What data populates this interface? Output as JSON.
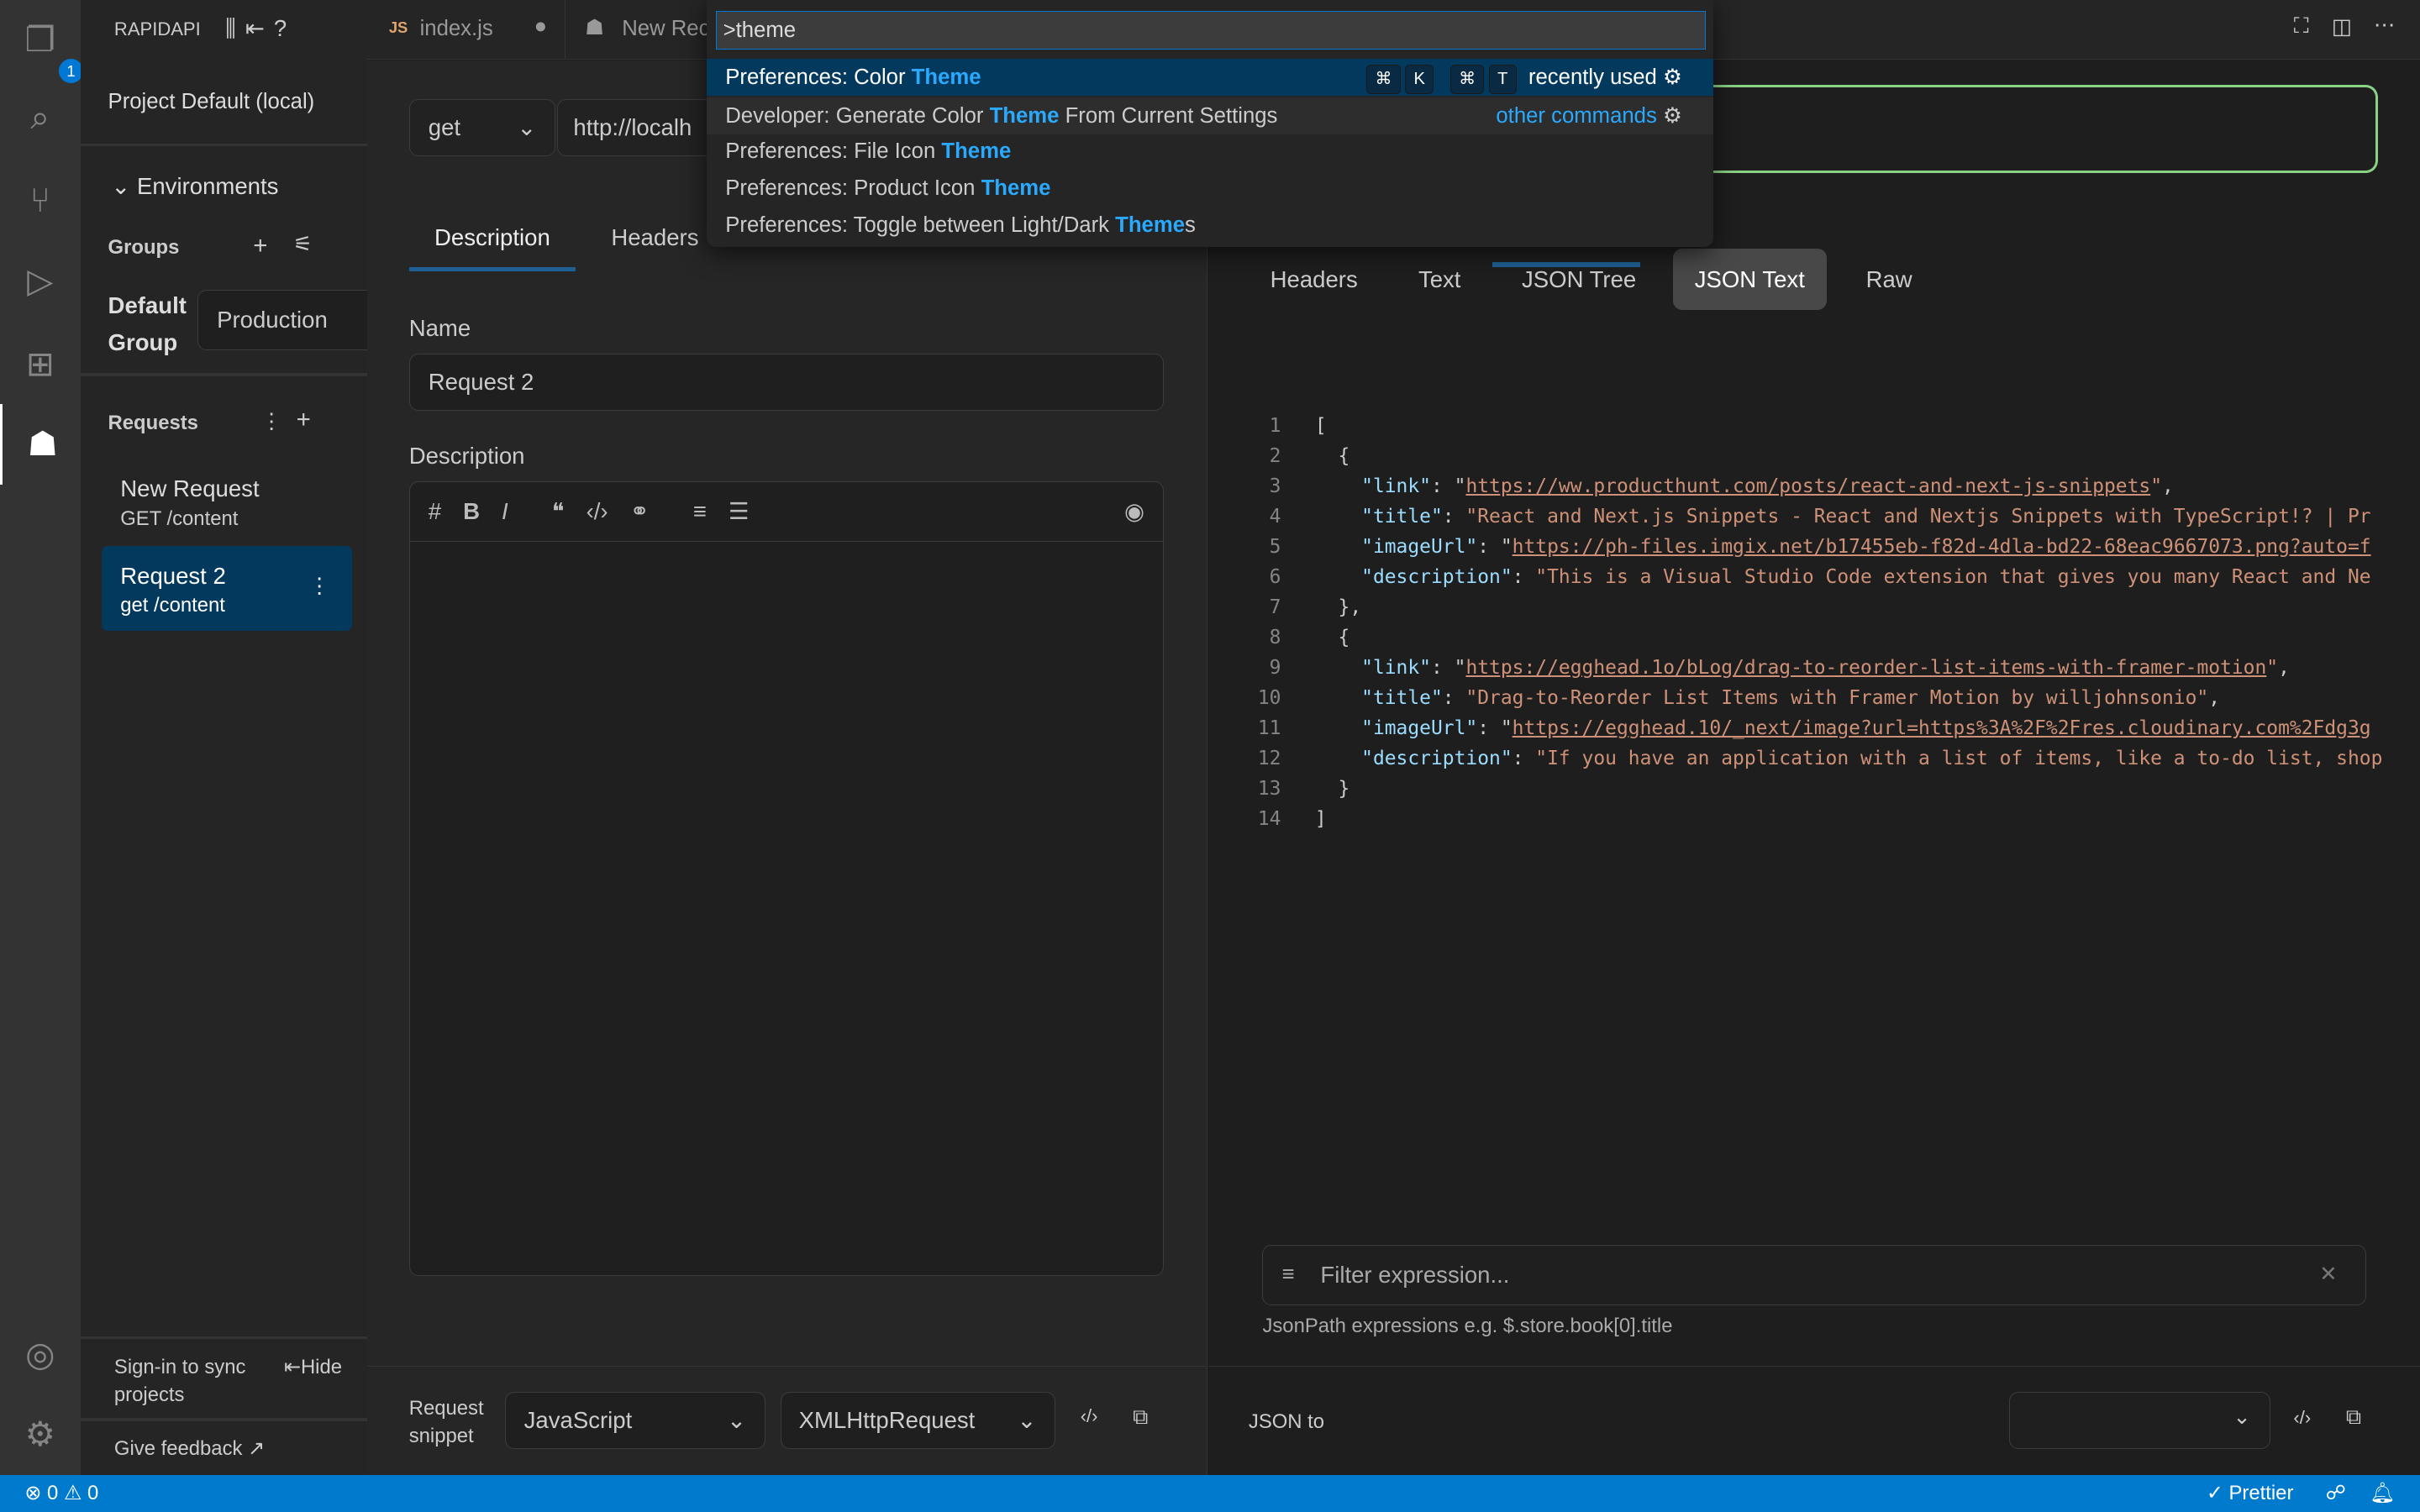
{
  "activity_bar": {
    "explorer_badge": "1",
    "icons": [
      "files-icon",
      "search-icon",
      "source-control-icon",
      "run-debug-icon",
      "extensions-icon",
      "rapidapi-icon",
      "account-icon",
      "settings-gear-icon"
    ]
  },
  "sidebar": {
    "title": "RAPIDAPI",
    "project": "Project Default (local)",
    "environments_label": "Environments",
    "groups_label": "Groups",
    "default_group": "Default Group",
    "env_value": "Production",
    "requests_label": "Requests",
    "requests": [
      {
        "name": "New Request",
        "method_path": "GET /content"
      },
      {
        "name": "Request 2",
        "method_path": "get /content"
      }
    ],
    "sign_in": "Sign-in to sync projects",
    "hide": "Hide",
    "feedback": "Give feedback"
  },
  "tabs": [
    {
      "label": "index.js",
      "icon": "JS"
    },
    {
      "label": "New Rec"
    }
  ],
  "command_palette": {
    "input": ">theme",
    "items": [
      {
        "pre": "Preferences: Color ",
        "match": "Theme",
        "post": "",
        "keys": [
          "⌘",
          "K",
          "⌘",
          "T"
        ],
        "hint": "recently used"
      },
      {
        "pre": "Developer: Generate Color ",
        "match": "Theme",
        "post": " From Current Settings",
        "hint": "other commands"
      },
      {
        "pre": "Preferences: File Icon ",
        "match": "Theme",
        "post": ""
      },
      {
        "pre": "Preferences: Product Icon ",
        "match": "Theme",
        "post": ""
      },
      {
        "pre": "Preferences: Toggle between Light/Dark ",
        "match": "Theme",
        "post": "s"
      }
    ]
  },
  "request": {
    "method": "get",
    "url": "http://localh",
    "tabs": [
      "Description",
      "Headers"
    ],
    "name_label": "Name",
    "name_value": "Request 2",
    "description_label": "Description",
    "snippet_label": "Request snippet",
    "language": "JavaScript",
    "library": "XMLHttpRequest"
  },
  "response": {
    "tabs": [
      "Headers",
      "Text",
      "JSON Tree",
      "JSON Text",
      "Raw"
    ],
    "active_tab": "JSON Text",
    "lines": [
      [
        [
          "p",
          "["
        ]
      ],
      [
        [
          "p",
          "  {"
        ]
      ],
      [
        [
          "k",
          "    \"link\""
        ],
        [
          "p",
          ": \""
        ],
        [
          "u",
          "https://ww.producthunt.com/posts/react-and-next-js-snippets"
        ],
        [
          "s",
          "\""
        ],
        [
          "p",
          ","
        ]
      ],
      [
        [
          "k",
          "    \"title\""
        ],
        [
          "p",
          ": "
        ],
        [
          "s",
          "\"React and Next.js Snippets - React and Nextjs Snippets with TypeScript!? | Pr"
        ]
      ],
      [
        [
          "k",
          "    \"imageUrl\""
        ],
        [
          "p",
          ": \""
        ],
        [
          "u",
          "https://ph-files.imgix.net/b17455eb-f82d-4dla-bd22-68eac9667073.png?auto=f"
        ]
      ],
      [
        [
          "k",
          "    \"description\""
        ],
        [
          "p",
          ": "
        ],
        [
          "s",
          "\"This is a Visual Studio Code extension that gives you many React and Ne"
        ]
      ],
      [
        [
          "p",
          "  },"
        ]
      ],
      [
        [
          "p",
          "  {"
        ]
      ],
      [
        [
          "k",
          "    \"link\""
        ],
        [
          "p",
          ": \""
        ],
        [
          "u",
          "https://egghead.1o/bLog/drag-to-reorder-list-items-with-framer-motion"
        ],
        [
          "s",
          "\""
        ],
        [
          "p",
          ","
        ]
      ],
      [
        [
          "k",
          "    \"title\""
        ],
        [
          "p",
          ": "
        ],
        [
          "s",
          "\"Drag-to-Reorder List Items with Framer Motion by willjohnsonio\""
        ],
        [
          "p",
          ","
        ]
      ],
      [
        [
          "k",
          "    \"imageUrl\""
        ],
        [
          "p",
          ": \""
        ],
        [
          "u",
          "https://egghead.10/_next/image?url=https%3A%2F%2Fres.cloudinary.com%2Fdg3g"
        ]
      ],
      [
        [
          "k",
          "    \"description\""
        ],
        [
          "p",
          ": "
        ],
        [
          "s",
          "\"If you have an application with a list of items, like a to-do list, shop"
        ]
      ],
      [
        [
          "p",
          "  }"
        ]
      ],
      [
        [
          "p",
          "]"
        ]
      ]
    ],
    "filter_placeholder": "Filter expression...",
    "filter_hint": "JsonPath expressions e.g. $.store.book[0].title",
    "json_to": "JSON to"
  },
  "status": {
    "errors": "0",
    "warnings": "0",
    "prettier": "Prettier"
  },
  "colors": {
    "accent": "#007acc",
    "match": "#2aaaff",
    "selected": "#04395e",
    "url_border": "#89d185"
  }
}
